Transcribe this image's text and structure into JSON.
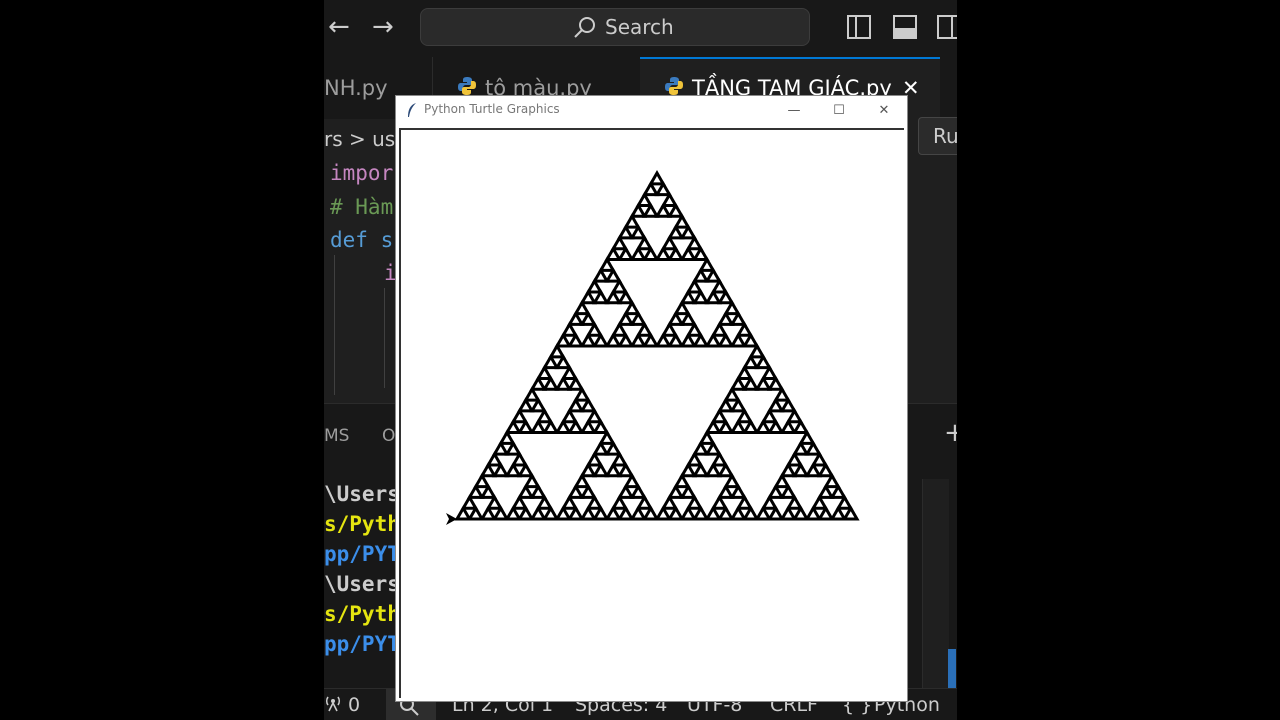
{
  "titlebar": {
    "back_icon": "arrow-left-icon",
    "forward_icon": "arrow-right-icon",
    "search_label": "Search",
    "layout_icons": [
      "toggle-primary-sidebar-icon",
      "toggle-panel-icon",
      "toggle-secondary-sidebar-icon"
    ]
  },
  "tabs": [
    {
      "label": "NH.py",
      "active": false
    },
    {
      "label": "tô màu.py",
      "active": false
    },
    {
      "label": "TẦNG TAM GIÁC.py",
      "active": true,
      "close": "✕"
    }
  ],
  "breadcrumb": {
    "text": "rs > us"
  },
  "run_button": {
    "label": "Ru"
  },
  "editor": {
    "lines": [
      {
        "text": "impor",
        "color": "#c586c0"
      },
      {
        "text": "# Hàm",
        "color": "#6a9955"
      },
      {
        "text": "def s",
        "color": "#569cd6"
      },
      {
        "text": "i",
        "color": "#c586c0"
      }
    ]
  },
  "panel": {
    "tabs": [
      "MS",
      "O"
    ],
    "add_icon": "+",
    "terminal_lines": [
      {
        "text": "\\Users",
        "color": "#cccccc"
      },
      {
        "text": "s/Pyth",
        "color": "#e5e510"
      },
      {
        "text": "pp/PYT",
        "color": "#3b8eea"
      },
      {
        "text": "\\Users",
        "color": "#cccccc"
      },
      {
        "text": "s/Pyth",
        "color": "#e5e510"
      },
      {
        "text": "pp/PYT",
        "color": "#3b8eea"
      }
    ]
  },
  "statusbar": {
    "ports": "0",
    "position": "Ln 2, Col 1",
    "spaces": "Spaces: 4",
    "encoding": "UTF-8",
    "eol": "CRLF",
    "language_icon": "{ }",
    "language": "Python"
  },
  "turtle_window": {
    "title": "Python Turtle Graphics",
    "minimize": "—",
    "maximize": "☐",
    "close": "✕",
    "fractal": {
      "type": "sierpinski-triangle",
      "depth": 5,
      "stroke_color": "#000000"
    }
  }
}
